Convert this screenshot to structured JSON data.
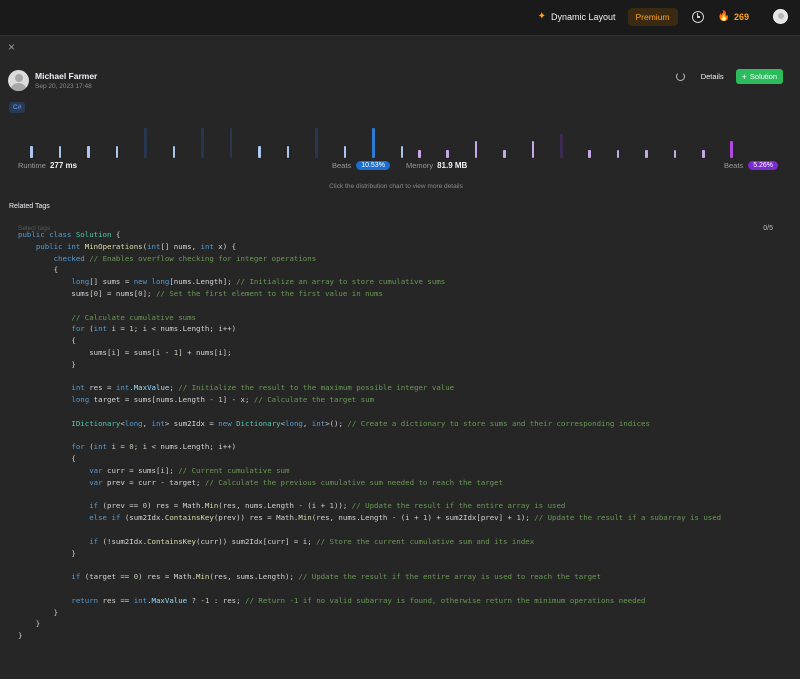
{
  "topbar": {
    "dynamic_layout_label": "Dynamic Layout",
    "premium_label": "Premium",
    "streak_count": "269"
  },
  "panel": {
    "close_label": "×"
  },
  "author": {
    "name": "Michael Farmer",
    "date": "Sep 20, 2023 17:48"
  },
  "actions": {
    "details_label": "Details",
    "solution_label": "Solution",
    "solution_plus": "+"
  },
  "language_tag": "C#",
  "stats": {
    "runtime_label": "Runtime",
    "runtime_value": "277 ms",
    "runtime_beats_label": "Beats",
    "runtime_beats_value": "10.53%",
    "memory_label": "Memory",
    "memory_value": "81.9 MB",
    "memory_beats_label": "Beats",
    "memory_beats_value": "5.26%",
    "hint": "Click the distribution chart to view more details"
  },
  "related_tags": {
    "title": "Related Tags",
    "placeholder": "Select tags",
    "count": "0/5"
  },
  "colors": {
    "accent_orange": "#ffa116",
    "accent_green": "#2cbb5d",
    "runtime_blue": "#1a6fd0",
    "memory_purple": "#7b2cd0"
  },
  "code_lines": [
    [
      [
        "kw",
        "public"
      ],
      [
        "p",
        " "
      ],
      [
        "kw",
        "class"
      ],
      [
        "p",
        " "
      ],
      [
        "ty",
        "Solution"
      ],
      [
        "p",
        " {"
      ]
    ],
    [
      [
        "p",
        "    "
      ],
      [
        "kw",
        "public"
      ],
      [
        "p",
        " "
      ],
      [
        "kw",
        "int"
      ],
      [
        "p",
        " "
      ],
      [
        "fn",
        "MinOperations"
      ],
      [
        "p",
        "("
      ],
      [
        "kw",
        "int"
      ],
      [
        "p",
        "[] nums, "
      ],
      [
        "kw",
        "int"
      ],
      [
        "p",
        " x) {"
      ]
    ],
    [
      [
        "p",
        "        "
      ],
      [
        "kw",
        "checked"
      ],
      [
        "p",
        " "
      ],
      [
        "cm",
        "// Enables overflow checking for integer operations"
      ]
    ],
    [
      [
        "p",
        "        {"
      ]
    ],
    [
      [
        "p",
        "            "
      ],
      [
        "kw",
        "long"
      ],
      [
        "p",
        "[] sums = "
      ],
      [
        "kw",
        "new"
      ],
      [
        "p",
        " "
      ],
      [
        "kw",
        "long"
      ],
      [
        "p",
        "[nums.Length]; "
      ],
      [
        "cm",
        "// Initialize an array to store cumulative sums"
      ]
    ],
    [
      [
        "p",
        "            sums["
      ],
      [
        "nm",
        "0"
      ],
      [
        "p",
        "] = nums["
      ],
      [
        "nm",
        "0"
      ],
      [
        "p",
        "]; "
      ],
      [
        "cm",
        "// Set the first element to the first value in nums"
      ]
    ],
    [
      [
        "p",
        ""
      ]
    ],
    [
      [
        "p",
        "            "
      ],
      [
        "cm",
        "// Calculate cumulative sums"
      ]
    ],
    [
      [
        "p",
        "            "
      ],
      [
        "kw",
        "for"
      ],
      [
        "p",
        " ("
      ],
      [
        "kw",
        "int"
      ],
      [
        "p",
        " i = "
      ],
      [
        "nm",
        "1"
      ],
      [
        "p",
        "; i < nums.Length; i++)"
      ]
    ],
    [
      [
        "p",
        "            {"
      ]
    ],
    [
      [
        "p",
        "                sums[i] = sums[i - "
      ],
      [
        "nm",
        "1"
      ],
      [
        "p",
        "] + nums[i];"
      ]
    ],
    [
      [
        "p",
        "            }"
      ]
    ],
    [
      [
        "p",
        ""
      ]
    ],
    [
      [
        "p",
        "            "
      ],
      [
        "kw",
        "int"
      ],
      [
        "p",
        " res = "
      ],
      [
        "kw",
        "int"
      ],
      [
        "p",
        "."
      ],
      [
        "vr",
        "MaxValue"
      ],
      [
        "p",
        "; "
      ],
      [
        "cm",
        "// Initialize the result to the maximum possible integer value"
      ]
    ],
    [
      [
        "p",
        "            "
      ],
      [
        "kw",
        "long"
      ],
      [
        "p",
        " target = sums[nums.Length - "
      ],
      [
        "nm",
        "1"
      ],
      [
        "p",
        "] - x; "
      ],
      [
        "cm",
        "// Calculate the target sum"
      ]
    ],
    [
      [
        "p",
        ""
      ]
    ],
    [
      [
        "p",
        "            "
      ],
      [
        "ty",
        "IDictionary"
      ],
      [
        "p",
        "<"
      ],
      [
        "kw",
        "long"
      ],
      [
        "p",
        ", "
      ],
      [
        "kw",
        "int"
      ],
      [
        "p",
        "> sum2Idx = "
      ],
      [
        "kw",
        "new"
      ],
      [
        "p",
        " "
      ],
      [
        "ty",
        "Dictionary"
      ],
      [
        "p",
        "<"
      ],
      [
        "kw",
        "long"
      ],
      [
        "p",
        ", "
      ],
      [
        "kw",
        "int"
      ],
      [
        "p",
        ">(); "
      ],
      [
        "cm",
        "// Create a dictionary to store sums and their corresponding indices"
      ]
    ],
    [
      [
        "p",
        ""
      ]
    ],
    [
      [
        "p",
        "            "
      ],
      [
        "kw",
        "for"
      ],
      [
        "p",
        " ("
      ],
      [
        "kw",
        "int"
      ],
      [
        "p",
        " i = "
      ],
      [
        "nm",
        "0"
      ],
      [
        "p",
        "; i < nums.Length; i++)"
      ]
    ],
    [
      [
        "p",
        "            {"
      ]
    ],
    [
      [
        "p",
        "                "
      ],
      [
        "kw",
        "var"
      ],
      [
        "p",
        " curr = sums[i]; "
      ],
      [
        "cm",
        "// Current cumulative sum"
      ]
    ],
    [
      [
        "p",
        "                "
      ],
      [
        "kw",
        "var"
      ],
      [
        "p",
        " prev = curr - target; "
      ],
      [
        "cm",
        "// Calculate the previous cumulative sum needed to reach the target"
      ]
    ],
    [
      [
        "p",
        ""
      ]
    ],
    [
      [
        "p",
        "                "
      ],
      [
        "kw",
        "if"
      ],
      [
        "p",
        " (prev == "
      ],
      [
        "nm",
        "0"
      ],
      [
        "p",
        ") res = Math."
      ],
      [
        "fn",
        "Min"
      ],
      [
        "p",
        "(res, nums.Length - (i + "
      ],
      [
        "nm",
        "1"
      ],
      [
        "p",
        ")); "
      ],
      [
        "cm",
        "// Update the result if the entire array is used"
      ]
    ],
    [
      [
        "p",
        "                "
      ],
      [
        "kw",
        "else"
      ],
      [
        "p",
        " "
      ],
      [
        "kw",
        "if"
      ],
      [
        "p",
        " (sum2Idx."
      ],
      [
        "fn",
        "ContainsKey"
      ],
      [
        "p",
        "(prev)) res = Math."
      ],
      [
        "fn",
        "Min"
      ],
      [
        "p",
        "(res, nums.Length - (i + "
      ],
      [
        "nm",
        "1"
      ],
      [
        "p",
        ") + sum2Idx[prev] + "
      ],
      [
        "nm",
        "1"
      ],
      [
        "p",
        "); "
      ],
      [
        "cm",
        "// Update the result if a subarray is used"
      ]
    ],
    [
      [
        "p",
        ""
      ]
    ],
    [
      [
        "p",
        "                "
      ],
      [
        "kw",
        "if"
      ],
      [
        "p",
        " (!sum2Idx."
      ],
      [
        "fn",
        "ContainsKey"
      ],
      [
        "p",
        "(curr)) sum2Idx[curr] = i; "
      ],
      [
        "cm",
        "// Store the current cumulative sum and its index"
      ]
    ],
    [
      [
        "p",
        "            }"
      ]
    ],
    [
      [
        "p",
        ""
      ]
    ],
    [
      [
        "p",
        "            "
      ],
      [
        "kw",
        "if"
      ],
      [
        "p",
        " (target == "
      ],
      [
        "nm",
        "0"
      ],
      [
        "p",
        ") res = Math."
      ],
      [
        "fn",
        "Min"
      ],
      [
        "p",
        "(res, sums.Length); "
      ],
      [
        "cm",
        "// Update the result if the entire array is used to reach the target"
      ]
    ],
    [
      [
        "p",
        ""
      ]
    ],
    [
      [
        "p",
        "            "
      ],
      [
        "kw",
        "return"
      ],
      [
        "p",
        " res == "
      ],
      [
        "kw",
        "int"
      ],
      [
        "p",
        "."
      ],
      [
        "vr",
        "MaxValue"
      ],
      [
        "p",
        " ? -"
      ],
      [
        "nm",
        "1"
      ],
      [
        "p",
        " : res; "
      ],
      [
        "cm",
        "// Return -1 if no valid subarray is found, otherwise return the minimum operations needed"
      ]
    ],
    [
      [
        "p",
        "        }"
      ]
    ],
    [
      [
        "p",
        "    }"
      ]
    ],
    [
      [
        "p",
        "}"
      ]
    ]
  ],
  "distribution": {
    "runtime_bars": [
      {
        "h": 0.4,
        "color": "#a9c8ee"
      },
      {
        "h": 0.4,
        "color": "#a9c8ee"
      },
      {
        "h": 0.4,
        "color": "#a9c8ee"
      },
      {
        "h": 0.4,
        "color": "#a9c8ee"
      },
      {
        "h": 1.0,
        "color": "#26374f"
      },
      {
        "h": 0.4,
        "color": "#a9c8ee"
      },
      {
        "h": 1.0,
        "color": "#26374f"
      },
      {
        "h": 1.0,
        "color": "#26374f"
      },
      {
        "h": 0.4,
        "color": "#a9c8ee"
      },
      {
        "h": 0.4,
        "color": "#a9c8ee"
      },
      {
        "h": 1.0,
        "color": "#26374f"
      },
      {
        "h": 0.4,
        "color": "#a9c8ee"
      },
      {
        "h": 1.0,
        "color": "#2a7ad6"
      },
      {
        "h": 0.4,
        "color": "#a9c8ee"
      }
    ],
    "memory_bars": [
      {
        "h": 0.28,
        "color": "#c9a8e8"
      },
      {
        "h": 0.28,
        "color": "#c9a8e8"
      },
      {
        "h": 0.55,
        "color": "#c9a8e8"
      },
      {
        "h": 0.28,
        "color": "#c9a8e8"
      },
      {
        "h": 0.55,
        "color": "#c9a8e8"
      },
      {
        "h": 0.8,
        "color": "#3d2a50"
      },
      {
        "h": 0.28,
        "color": "#c9a8e8"
      },
      {
        "h": 0.28,
        "color": "#c9a8e8"
      },
      {
        "h": 0.28,
        "color": "#c9a8e8"
      },
      {
        "h": 0.28,
        "color": "#c9a8e8"
      },
      {
        "h": 0.28,
        "color": "#c9a8e8"
      },
      {
        "h": 0.55,
        "color": "#b14ae0"
      }
    ]
  }
}
